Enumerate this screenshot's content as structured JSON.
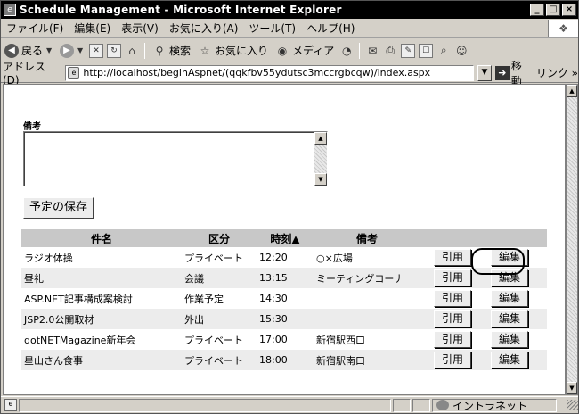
{
  "window": {
    "title": "Schedule Management - Microsoft Internet Explorer",
    "controls": [
      "_",
      "□",
      "×"
    ]
  },
  "menu": [
    "ファイル(F)",
    "編集(E)",
    "表示(V)",
    "お気に入り(A)",
    "ツール(T)",
    "ヘルプ(H)"
  ],
  "toolbar": {
    "back": "戻る",
    "search": "検索",
    "favorites": "お気に入り",
    "media": "メディア"
  },
  "address": {
    "label": "アドレス(D)",
    "url": "http://localhost/beginAspnet/(qqkfbv55ydutsc3mccrgbcqw)/index.aspx",
    "go": "移動",
    "links": "リンク »"
  },
  "form": {
    "note_label": "備考",
    "note_value": "",
    "save_button": "予定の保存"
  },
  "table": {
    "headers": [
      "件名",
      "区分",
      "時刻▲",
      "備考",
      "",
      ""
    ],
    "rows": [
      {
        "title": "ラジオ体操",
        "category": "プライベート",
        "time": "12:20",
        "note": "○×広場",
        "quote": "引用",
        "edit": "編集"
      },
      {
        "title": "昼礼",
        "category": "会議",
        "time": "13:15",
        "note": "ミーティングコーナ",
        "quote": "引用",
        "edit": "編集"
      },
      {
        "title": "ASP.NET記事構成案検討",
        "category": "作業予定",
        "time": "14:30",
        "note": "",
        "quote": "引用",
        "edit": "編集"
      },
      {
        "title": "JSP2.0公開取材",
        "category": "外出",
        "time": "15:30",
        "note": "",
        "quote": "引用",
        "edit": "編集"
      },
      {
        "title": "dotNETMagazine新年会",
        "category": "プライベート",
        "time": "17:00",
        "note": "新宿駅西口",
        "quote": "引用",
        "edit": "編集"
      },
      {
        "title": "星山さん食事",
        "category": "プライベート",
        "time": "18:00",
        "note": "新宿駅南口",
        "quote": "引用",
        "edit": "編集"
      }
    ]
  },
  "status": {
    "zone": "イントラネット"
  }
}
